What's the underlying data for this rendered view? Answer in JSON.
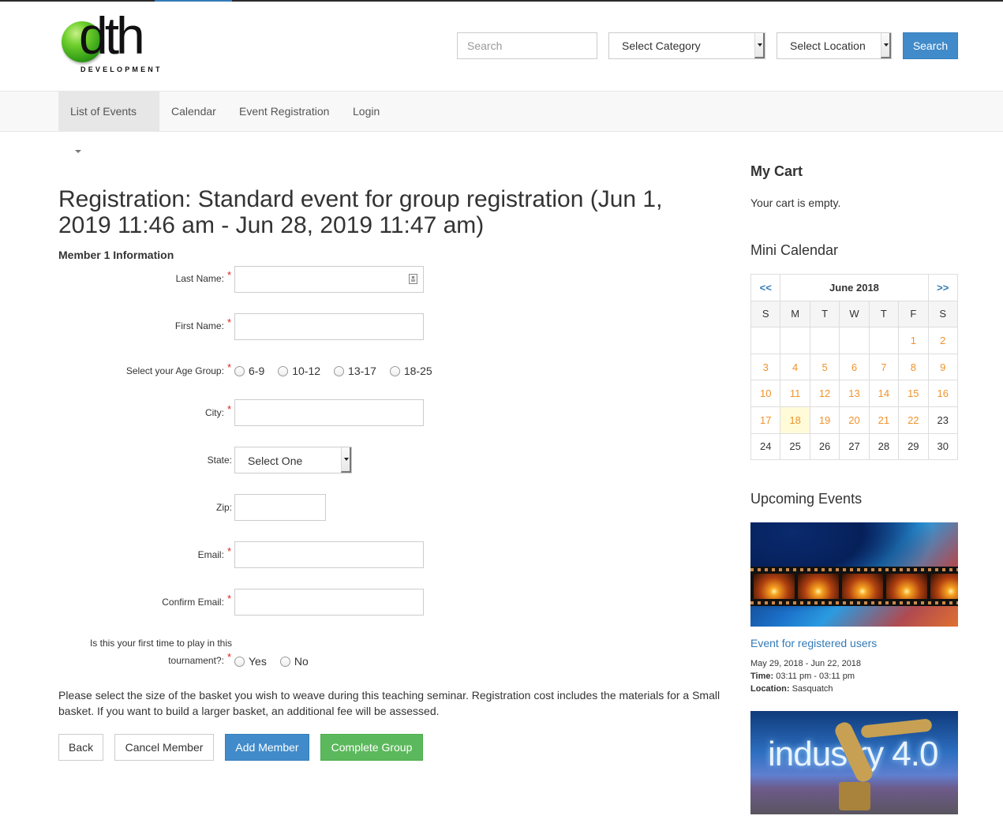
{
  "header": {
    "logo": {
      "word": "dth",
      "sub": "DEVELOPMENT"
    },
    "search": {
      "placeholder": "Search",
      "value": ""
    },
    "category_select": {
      "selected": "Select Category"
    },
    "location_select": {
      "selected": "Select Location"
    },
    "search_button": "Search"
  },
  "nav": {
    "items": [
      {
        "label": "List of Events",
        "has_dropdown": true,
        "active": true
      },
      {
        "label": "Calendar"
      },
      {
        "label": "Event Registration"
      },
      {
        "label": "Login"
      }
    ]
  },
  "main": {
    "title": "Registration: Standard event for group registration (Jun 1, 2019 11:46 am - Jun 28, 2019 11:47 am)",
    "member_heading": "Member 1 Information",
    "fields": {
      "last_name": {
        "label": "Last Name:",
        "required": "*",
        "value": ""
      },
      "first_name": {
        "label": "First Name:",
        "required": "*",
        "value": ""
      },
      "age_group": {
        "label": "Select your Age Group:",
        "required": "*",
        "options": [
          "6-9",
          "10-12",
          "13-17",
          "18-25"
        ]
      },
      "city": {
        "label": "City:",
        "required": "*",
        "value": ""
      },
      "state": {
        "label": "State:",
        "selected": "Select One"
      },
      "zip": {
        "label": "Zip:",
        "value": ""
      },
      "email": {
        "label": "Email:",
        "required": "*",
        "value": ""
      },
      "confirm_email": {
        "label": "Confirm Email:",
        "required": "*",
        "value": ""
      },
      "first_time": {
        "label_line1": "Is this your first time to play in this",
        "label_line2": "tournament?:",
        "required": "*",
        "options": [
          "Yes",
          "No"
        ]
      }
    },
    "note": "Please select the size of the basket you wish to weave during this teaching seminar. Registration cost includes the materials for a Small basket. If you want to build a larger basket, an additional fee will be assessed.",
    "buttons": {
      "back": "Back",
      "cancel_member": "Cancel Member",
      "add_member": "Add Member",
      "complete_group": "Complete Group"
    }
  },
  "sidebar": {
    "cart": {
      "heading": "My Cart",
      "empty_text": "Your cart is empty."
    },
    "mini_calendar": {
      "heading": "Mini Calendar",
      "prev": "<<",
      "next": ">>",
      "month": "June 2018",
      "weekdays": [
        "S",
        "M",
        "T",
        "W",
        "T",
        "F",
        "S"
      ],
      "weeks": [
        [
          "",
          "",
          "",
          "",
          "",
          "1",
          "2"
        ],
        [
          "3",
          "4",
          "5",
          "6",
          "7",
          "8",
          "9"
        ],
        [
          "10",
          "11",
          "12",
          "13",
          "14",
          "15",
          "16"
        ],
        [
          "17",
          "18",
          "19",
          "20",
          "21",
          "22",
          "23"
        ],
        [
          "24",
          "25",
          "26",
          "27",
          "28",
          "29",
          "30"
        ]
      ],
      "event_days_through": 22,
      "today": "18"
    },
    "upcoming": {
      "heading": "Upcoming Events",
      "events": [
        {
          "title": "Event for registered users",
          "dates": "May 29, 2018 - Jun 22, 2018",
          "time_label": "Time:",
          "time": "03:11 pm - 03:11 pm",
          "location_label": "Location:",
          "location": "Sasquatch",
          "image": "film-strip-sunset-image"
        },
        {
          "image": "industry-4-robot-arm-image",
          "image_text": "industry 4.0"
        }
      ]
    }
  },
  "colors": {
    "primary": "#428bca",
    "success": "#5cb85c",
    "link": "#337ab7",
    "calendar_event_day": "#f0932b",
    "calendar_today_bg": "#fffbd9",
    "required": "#e31b1b"
  }
}
